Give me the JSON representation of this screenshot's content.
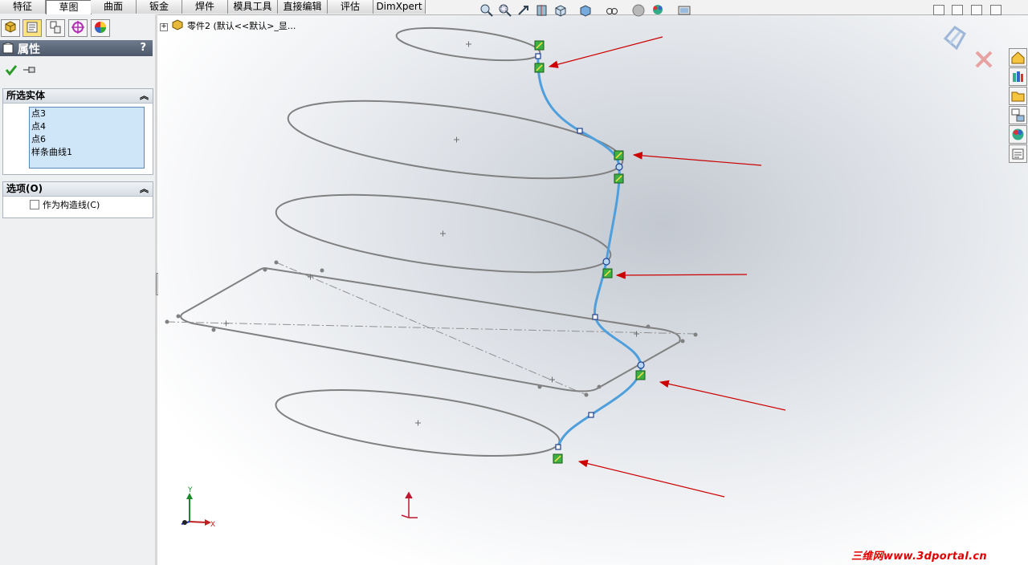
{
  "tabs": [
    "特征",
    "草图",
    "曲面",
    "钣金",
    "焊件",
    "模具工具",
    "直接编辑",
    "评估",
    "DimXpert"
  ],
  "active_tab": "草图",
  "property_panel": {
    "title": "属性",
    "help": "?"
  },
  "selected_entities": {
    "title": "所选实体",
    "items": [
      "点3",
      "点4",
      "点6",
      "样条曲线1"
    ]
  },
  "options": {
    "title": "选项(O)",
    "construction_label": "作为构造线(C)",
    "construction_checked": false
  },
  "tree_flyout": {
    "expander": "+",
    "text": "零件2  (默认<<默认>_显..."
  },
  "triad": {
    "x": "X",
    "y": "Y"
  },
  "watermark": "三维网www.3dportal.cn",
  "colors": {
    "spline": "#4f9fdc",
    "sketch": "#808080",
    "arrow": "#cc0000",
    "relation_icon": "#3cb043",
    "origin": "#c01830"
  },
  "icons": {
    "hud": [
      "zoom-fit-icon",
      "zoom-area-icon",
      "previous-view-icon",
      "section-view-icon",
      "view-orientation-icon",
      "display-style-icon",
      "hide-show-icon",
      "edit-appearance-icon",
      "scene-icon",
      "view-settings-icon"
    ],
    "task_pane": [
      "home-icon",
      "design-library-icon",
      "file-explorer-icon",
      "view-palette-icon",
      "appearances-icon",
      "custom-properties-icon"
    ]
  }
}
